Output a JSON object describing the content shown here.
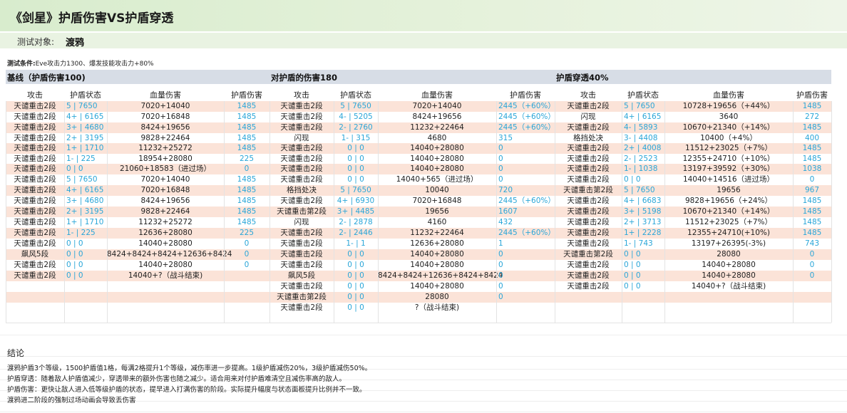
{
  "title": "《剑星》护盾伤害VS护盾穿透",
  "subject": {
    "label": "测试对象:",
    "value": "渡鸦"
  },
  "condition": {
    "label": "测试条件:",
    "text": "Eve攻击力1300、爆发技能攻击力+80%"
  },
  "sections": {
    "baseline": "基线（护盾伤害100)",
    "shield_dmg": "对护盾的伤害180",
    "penetration": "护盾穿透40%"
  },
  "column_headers": {
    "attack": "攻击",
    "shield_state": "护盾状态",
    "hp_dmg": "血量伤害",
    "shield_dmg": "护盾伤害"
  },
  "rows": [
    [
      "天谴重击2段",
      "5 | 7650",
      "7020+14040",
      "1485",
      "天谴重击2段",
      "5 | 7650",
      "7020+14040",
      "2445（+60%）",
      "天谴重击2段",
      "5 | 7650",
      "10728+19656（+44%）",
      "1485"
    ],
    [
      "天谴重击2段",
      "4+ | 6165",
      "7020+16848",
      "1485",
      "天谴重击2段",
      "4- | 5205",
      "8424+19656",
      "2445（+60%）",
      "闪现",
      "4+ | 6165",
      "3640",
      "272"
    ],
    [
      "天谴重击2段",
      "3+ | 4680",
      "8424+19656",
      "1485",
      "天谴重击2段",
      "2- | 2760",
      "11232+22464",
      "2445（+60%）",
      "天谴重击2段",
      "4- | 5893",
      "10670+21340（+14%）",
      "1485"
    ],
    [
      "天谴重击2段",
      "2+ | 3195",
      "9828+22464",
      "1485",
      "闪现",
      "1- | 315",
      "4680",
      "315",
      "格挡处决",
      "3- | 4408",
      "10400（+4%）",
      "400"
    ],
    [
      "天谴重击2段",
      "1+ | 1710",
      "11232+25272",
      "1485",
      "天谴重击2段",
      "0 | 0",
      "14040+28080",
      "0",
      "天谴重击2段",
      "2+ | 4008",
      "11512+23025（+7%）",
      "1485"
    ],
    [
      "天谴重击2段",
      "1- | 225",
      "18954+28080",
      "225",
      "天谴重击2段",
      "0 | 0",
      "14040+28080",
      "0",
      "天谴重击2段",
      "2- | 2523",
      "12355+24710（+10%）",
      "1485"
    ],
    [
      "天谴重击2段",
      "0 | 0",
      "21060+18583（进过场）",
      "0",
      "天谴重击2段",
      "0 | 0",
      "14040+28080",
      "0",
      "天谴重击2段",
      "1- | 1038",
      "13197+39592（+30%）",
      "1038"
    ],
    [
      "天谴重击2段",
      "5 | 7650",
      "7020+14040",
      "1485",
      "天谴重击2段",
      "0 | 0",
      "14040+565（进过场）",
      "0",
      "天谴重击2段",
      "0 | 0",
      "14040+14516（进过场）",
      "0"
    ],
    [
      "天谴重击2段",
      "4+ | 6165",
      "7020+16848",
      "1485",
      "格挡处决",
      "5 | 7650",
      "10040",
      "720",
      "天谴重击第2段",
      "5 | 7650",
      "19656",
      "967"
    ],
    [
      "天谴重击2段",
      "3+ | 4680",
      "8424+19656",
      "1485",
      "天谴重击2段",
      "4+ | 6930",
      "7020+16848",
      "2445（+60%）",
      "天谴重击2段",
      "4+ | 6683",
      "9828+19656（+24%）",
      "1485"
    ],
    [
      "天谴重击2段",
      "2+ | 3195",
      "9828+22464",
      "1485",
      "天谴重击第2段",
      "3+ | 4485",
      "19656",
      "1607",
      "天谴重击2段",
      "3+ | 5198",
      "10670+21340（+14%）",
      "1485"
    ],
    [
      "天谴重击2段",
      "1+ | 1710",
      "11232+25272",
      "1485",
      "闪现",
      "2- | 2878",
      "4160",
      "432",
      "天谴重击2段",
      "2+ | 3713",
      "11512+23025（+7%）",
      "1485"
    ],
    [
      "天谴重击2段",
      "1- | 225",
      "12636+28080",
      "225",
      "天谴重击2段",
      "2- | 2446",
      "11232+22464",
      "2445（+60%）",
      "天谴重击2段",
      "1+ | 2228",
      "12355+24710(+10%)",
      "1485"
    ],
    [
      "天谴重击2段",
      "0 | 0",
      "14040+28080",
      "0",
      "天谴重击2段",
      "1- | 1",
      "12636+28080",
      "1",
      "天谴重击2段",
      "1- | 743",
      "13197+26395(-3%)",
      "743"
    ],
    [
      "飙风5段",
      "0 | 0",
      "8424+8424+8424+12636+8424",
      "0",
      "天谴重击2段",
      "0 | 0",
      "14040+28080",
      "0",
      "天谴重击第2段",
      "0 | 0",
      "28080",
      "0"
    ],
    [
      "天谴重击2段",
      "0 | 0",
      "14040+28080",
      "0",
      "天谴重击2段",
      "0 | 0",
      "14040+28080",
      "0",
      "天谴重击2段",
      "0 | 0",
      "14040+28080",
      "0"
    ],
    [
      "天谴重击2段",
      "0 | 0",
      "14040+?（战斗结束)",
      "",
      "飙风5段",
      "0 | 0",
      "8424+8424+12636+8424+8424",
      "0",
      "天谴重击2段",
      "0 | 0",
      "14040+28080",
      "0"
    ],
    [
      "",
      "",
      "",
      "",
      "天谴重击2段",
      "0 | 0",
      "14040+28080",
      "0",
      "天谴重击2段",
      "0 | 0",
      "14040+?（战斗结束)",
      ""
    ],
    [
      "",
      "",
      "",
      "",
      "天谴重击第2段",
      "0 | 0",
      "28080",
      "0",
      "",
      "",
      "",
      ""
    ],
    [
      "",
      "",
      "",
      "",
      "天谴重击2段",
      "0 | 0",
      "?（战斗结束)",
      "",
      "",
      "",
      "",
      ""
    ]
  ],
  "conclusion": {
    "title": "结论",
    "lines": [
      "渡鸦护盾3个等级，1500护盾值1格，每满2格提升1个等级，减伤率进一步提高。1级护盾减伤20%，3级护盾减伤50%。",
      "护盾穿透：随着敌人护盾值减少，穿透带来的额外伤害也随之减少。适合用来对付护盾难清空且减伤率高的敌人。",
      "护盾伤害：更快让敌人进入低等级护盾的状态，提早进入打满伤害的阶段。实际提升幅度与状态面板提升比例并不一致。",
      "渡鸦进二阶段的强制过场动画会导致丢伤害"
    ]
  },
  "colors": {
    "title_bg": "#d8eccd",
    "section_bg": "#d7dde6",
    "row_pink": "#fbe3d8",
    "value_blue": "#2aa6d8"
  }
}
